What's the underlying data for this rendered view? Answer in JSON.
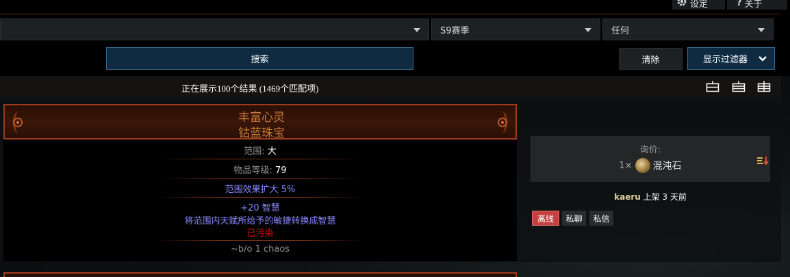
{
  "topbar": {
    "settings_label": "设定",
    "about_label": "关于",
    "about_icon_glyph": "?"
  },
  "filters": {
    "main_select_value": "",
    "season_select_value": "S9赛季",
    "status_select_value": "任何"
  },
  "actions": {
    "search_label": "搜索",
    "clear_label": "清除",
    "show_filters_label": "显示过滤器"
  },
  "results": {
    "count_text": "正在展示100个结果 (1469个匹配项)"
  },
  "item": {
    "name": "丰富心灵",
    "base_type": "钴蓝珠宝",
    "radius_label": "范围: ",
    "radius_value": "大",
    "item_level_label": "物品等级: ",
    "item_level_value": "79",
    "implicit_mod": "范围效果扩大 5%",
    "explicit_mod_1": "+20 智慧",
    "explicit_mod_2": "将范围内天赋所给予的敏捷转换成智慧",
    "corrupted": "已污染",
    "note": "~b/o 1 chaos"
  },
  "listing": {
    "price_label": "询价:",
    "price_quantity": "1×",
    "price_currency": "混沌石",
    "seller_name": "kaeru",
    "listed_text": " 上架 3 天前",
    "status_offline": "离线",
    "whisper_label": "私聊",
    "mail_label": "私信"
  },
  "colors": {
    "accent_blue": "#0e2b42",
    "unique_orange": "#c97a3a",
    "magic_blue": "#8888ff",
    "corrupted_red": "#d20000",
    "offline_red": "#c74040"
  }
}
